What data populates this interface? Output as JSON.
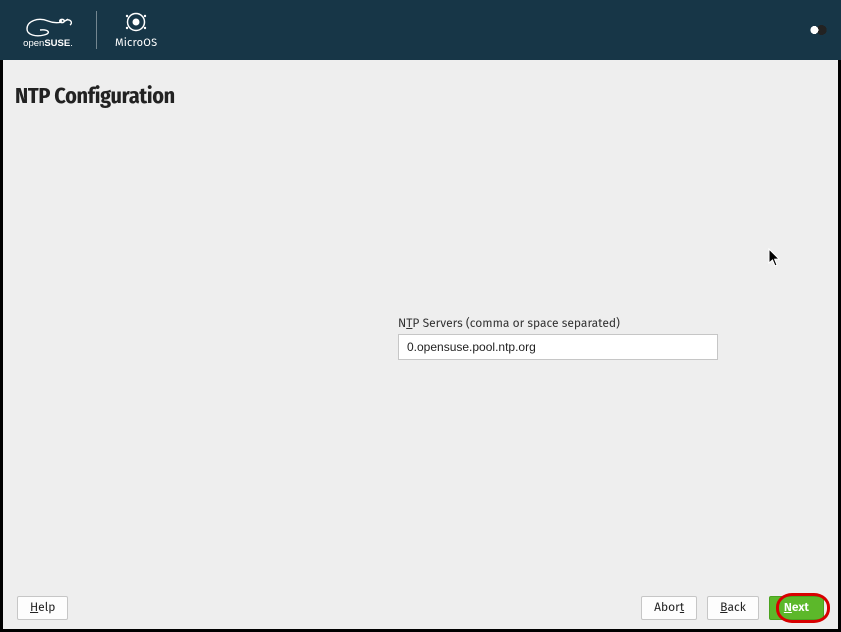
{
  "header": {
    "brand_primary": "openSUSE",
    "brand_secondary": "MicroOS"
  },
  "page": {
    "title": "NTP Configuration"
  },
  "form": {
    "ntp_label_pre": "N",
    "ntp_label_ul": "T",
    "ntp_label_post": "P Servers (comma or space separated)",
    "ntp_value": "0.opensuse.pool.ntp.org"
  },
  "footer": {
    "help_ul": "H",
    "help_rest": "elp",
    "abort_pre": "Abor",
    "abort_ul": "t",
    "back_ul": "B",
    "back_rest": "ack",
    "next_ul": "N",
    "next_rest": "ext"
  }
}
